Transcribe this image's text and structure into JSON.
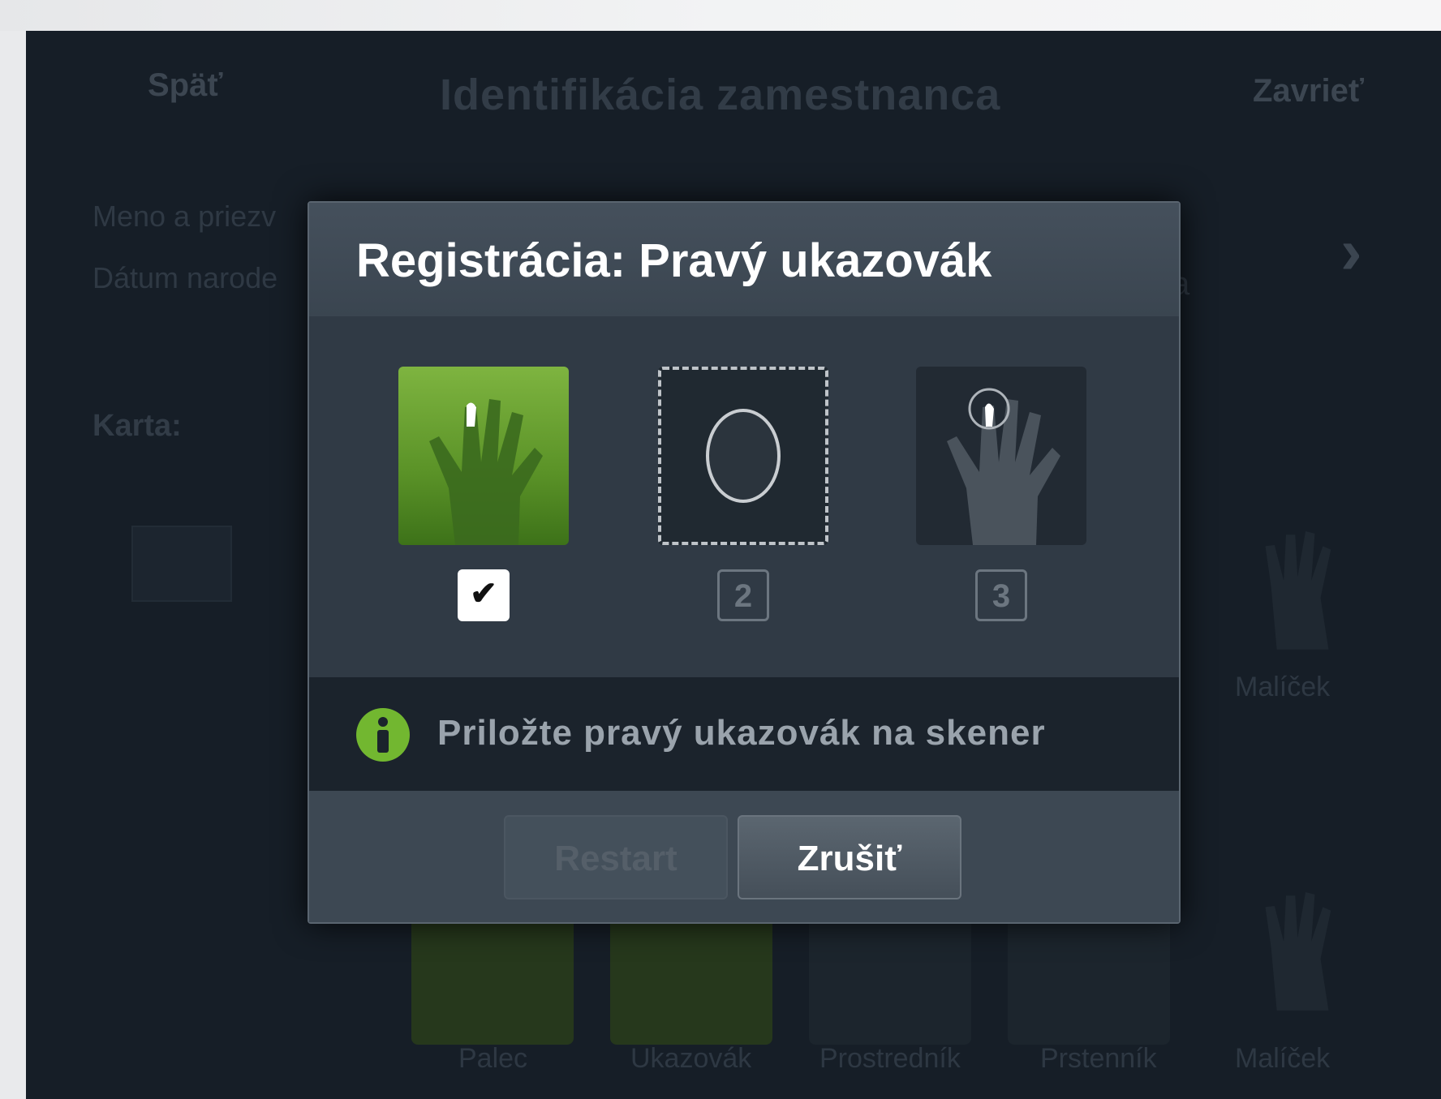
{
  "header": {
    "back_label": "Späť",
    "title": "Identifikácia zamestnanca",
    "close_label": "Zavrieť"
  },
  "form": {
    "name_label": "Meno a priezv",
    "dob_label": "Dátum narode",
    "partial_a": "a",
    "card_label": "Karta:"
  },
  "fingers": {
    "labels": [
      "Palec",
      "Ukazovák",
      "Prostredník",
      "Prstenník",
      "Malíček"
    ],
    "top_right_label": "Malíček"
  },
  "dialog": {
    "title": "Registrácia: Pravý ukazovák",
    "steps": [
      {
        "state": "done",
        "mark": "✔"
      },
      {
        "state": "active",
        "mark": "2"
      },
      {
        "state": "pending",
        "mark": "3"
      }
    ],
    "info_text": "Priložte pravý ukazovák na skener",
    "restart_label": "Restart",
    "cancel_label": "Zrušiť"
  },
  "colors": {
    "accent_green": "#72b730",
    "background": "#161e27",
    "dialog": "#3f4a56"
  },
  "icons": {
    "info": "info-icon",
    "check": "check-icon",
    "chevron": "chevron-right-icon",
    "hand": "hand-icon",
    "fingerprint": "fingerprint-icon"
  }
}
